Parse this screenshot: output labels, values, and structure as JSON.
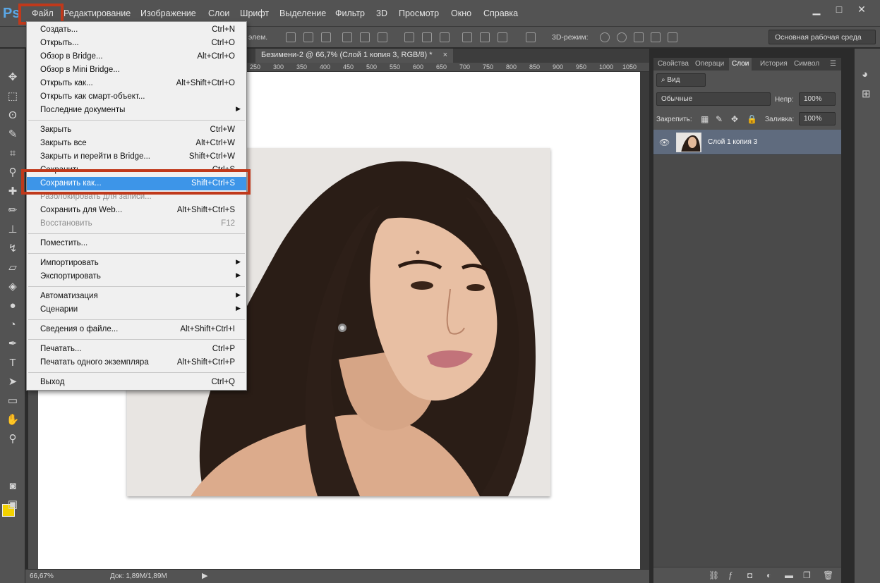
{
  "app": {
    "logo": "Ps"
  },
  "menubar": {
    "items": [
      "Файл",
      "Редактирование",
      "Изображение",
      "Слои",
      "Шрифт",
      "Выделение",
      "Фильтр",
      "3D",
      "Просмотр",
      "Окно",
      "Справка"
    ]
  },
  "window_controls": {
    "minimize": "▁",
    "maximize": "□",
    "close": "✕"
  },
  "optionsbar": {
    "auto_select_label": "элем.",
    "mode3d_label": "3D-режим:",
    "workspace": "Основная рабочая среда"
  },
  "document": {
    "tab_title": "Безимени-2 @ 66,7% (Слой 1 копия 3, RGB/8) *",
    "tab_close": "×",
    "ruler_ticks": [
      "250",
      "300",
      "350",
      "400",
      "450",
      "500",
      "550",
      "600",
      "650",
      "700",
      "750",
      "800",
      "850",
      "900",
      "950",
      "1000",
      "1050"
    ]
  },
  "status": {
    "zoom": "66,67%",
    "doc_size": "Док: 1,89M/1,89M",
    "arrow": "▶"
  },
  "file_menu": {
    "groups": [
      [
        {
          "label": "Создать...",
          "shortcut": "Ctrl+N"
        },
        {
          "label": "Открыть...",
          "shortcut": "Ctrl+O"
        },
        {
          "label": "Обзор в Bridge...",
          "shortcut": "Alt+Ctrl+O"
        },
        {
          "label": "Обзор в Mini Bridge...",
          "shortcut": ""
        },
        {
          "label": "Открыть как...",
          "shortcut": "Alt+Shift+Ctrl+O"
        },
        {
          "label": "Открыть как смарт-объект...",
          "shortcut": ""
        },
        {
          "label": "Последние документы",
          "shortcut": "",
          "submenu": true
        }
      ],
      [
        {
          "label": "Закрыть",
          "shortcut": "Ctrl+W"
        },
        {
          "label": "Закрыть все",
          "shortcut": "Alt+Ctrl+W"
        },
        {
          "label": "Закрыть и перейти в Bridge...",
          "shortcut": "Shift+Ctrl+W"
        },
        {
          "label": "Сохранить",
          "shortcut": "Ctrl+S"
        },
        {
          "label": "Сохранить как...",
          "shortcut": "Shift+Ctrl+S",
          "selected": true
        },
        {
          "label": "Разблокировать для записи...",
          "shortcut": "",
          "disabled": true
        },
        {
          "label": "Сохранить для Web...",
          "shortcut": "Alt+Shift+Ctrl+S"
        },
        {
          "label": "Восстановить",
          "shortcut": "F12",
          "disabled": true
        }
      ],
      [
        {
          "label": "Поместить...",
          "shortcut": ""
        }
      ],
      [
        {
          "label": "Импортировать",
          "shortcut": "",
          "submenu": true
        },
        {
          "label": "Экспортировать",
          "shortcut": "",
          "submenu": true
        }
      ],
      [
        {
          "label": "Автоматизация",
          "shortcut": "",
          "submenu": true
        },
        {
          "label": "Сценарии",
          "shortcut": "",
          "submenu": true
        }
      ],
      [
        {
          "label": "Сведения о файле...",
          "shortcut": "Alt+Shift+Ctrl+I"
        }
      ],
      [
        {
          "label": "Печатать...",
          "shortcut": "Ctrl+P"
        },
        {
          "label": "Печатать одного экземпляра",
          "shortcut": "Alt+Shift+Ctrl+P"
        }
      ],
      [
        {
          "label": "Выход",
          "shortcut": "Ctrl+Q"
        }
      ]
    ],
    "submenu_arrow": "▶"
  },
  "panels": {
    "tabs": [
      "Свойства",
      "Операци",
      "Слои",
      "История",
      "Символ"
    ],
    "active_tab": "Слои",
    "filter_kind": "Вид",
    "blend_mode": "Обычные",
    "opacity_label": "Непр:",
    "opacity_value": "100%",
    "lock_label": "Закрепить:",
    "fill_label": "Заливка:",
    "fill_value": "100%",
    "layers": [
      {
        "name": "Слой 1 копия 3"
      }
    ]
  },
  "colors": {
    "foreground": "#f3d200",
    "background": "#ffffff",
    "highlight_box": "#c0391b",
    "menu_selected": "#3d95e8"
  }
}
